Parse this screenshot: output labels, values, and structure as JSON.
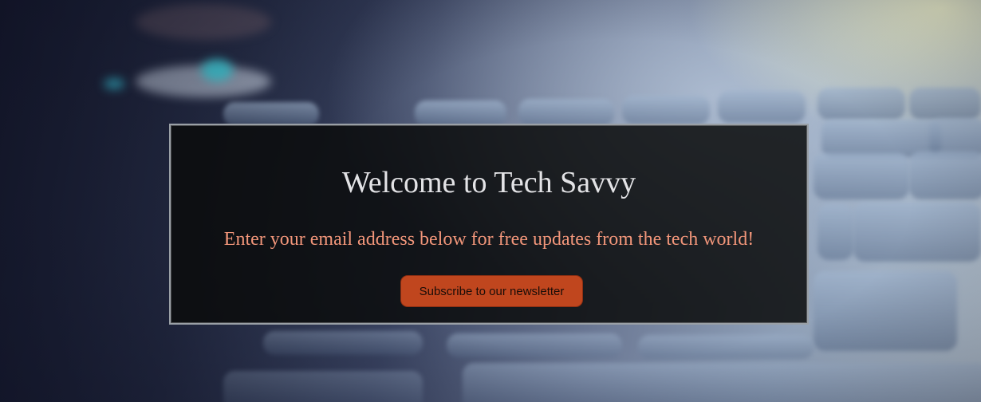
{
  "colors": {
    "panel_background": "#0a0c0c",
    "title_text": "#e3e3e6",
    "subtitle_text": "#f2967a",
    "button_background": "#c0461e",
    "button_text": "#1a0d08"
  },
  "hero": {
    "title": "Welcome to Tech Savvy",
    "subtitle": "Enter your email address below for free updates from the tech world!",
    "subscribe_label": "Subscribe to our newsletter"
  }
}
